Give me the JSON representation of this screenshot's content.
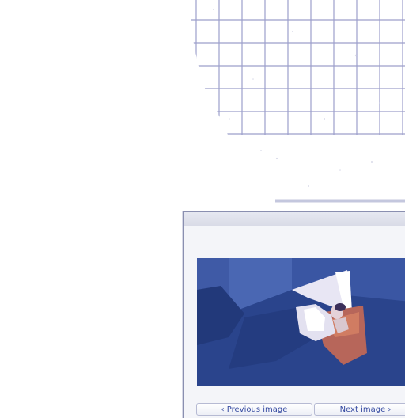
{
  "viewer": {
    "prev_label": "‹ Previous image",
    "next_label": "Next image ›"
  },
  "colors": {
    "accent": "#3348a0",
    "photo_tint": "#2f4b95",
    "grid_line": "#8b8fc2"
  }
}
